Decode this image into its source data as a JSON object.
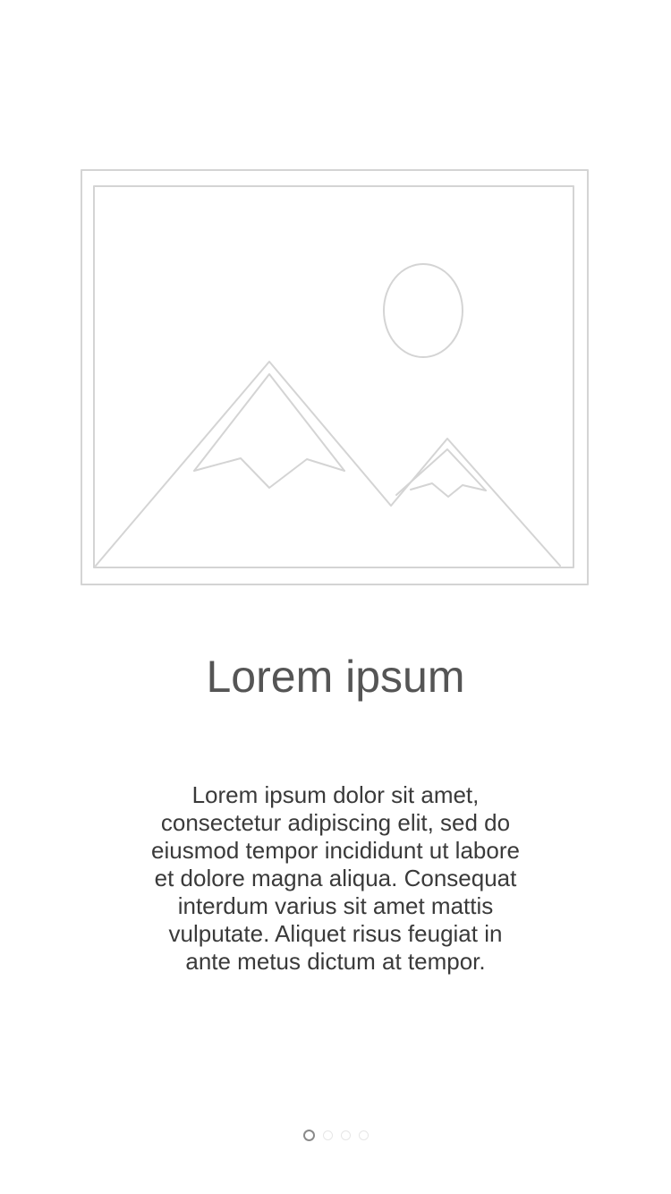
{
  "onboarding": {
    "image": {
      "icon": "image-placeholder-icon",
      "stroke_color": "#d2d2d2"
    },
    "title": "Lorem ipsum",
    "body": "Lorem ipsum dolor sit amet, consectetur adipiscing elit, sed do eiusmod tempor incididunt ut labore et dolore magna aliqua. Consequat interdum varius sit amet mattis vulputate. Aliquet risus feugiat in ante metus dictum at tempor."
  },
  "pager": {
    "total": 4,
    "current": 1,
    "active_color": "#8a8a8a",
    "inactive_color": "#e6e6e6"
  }
}
